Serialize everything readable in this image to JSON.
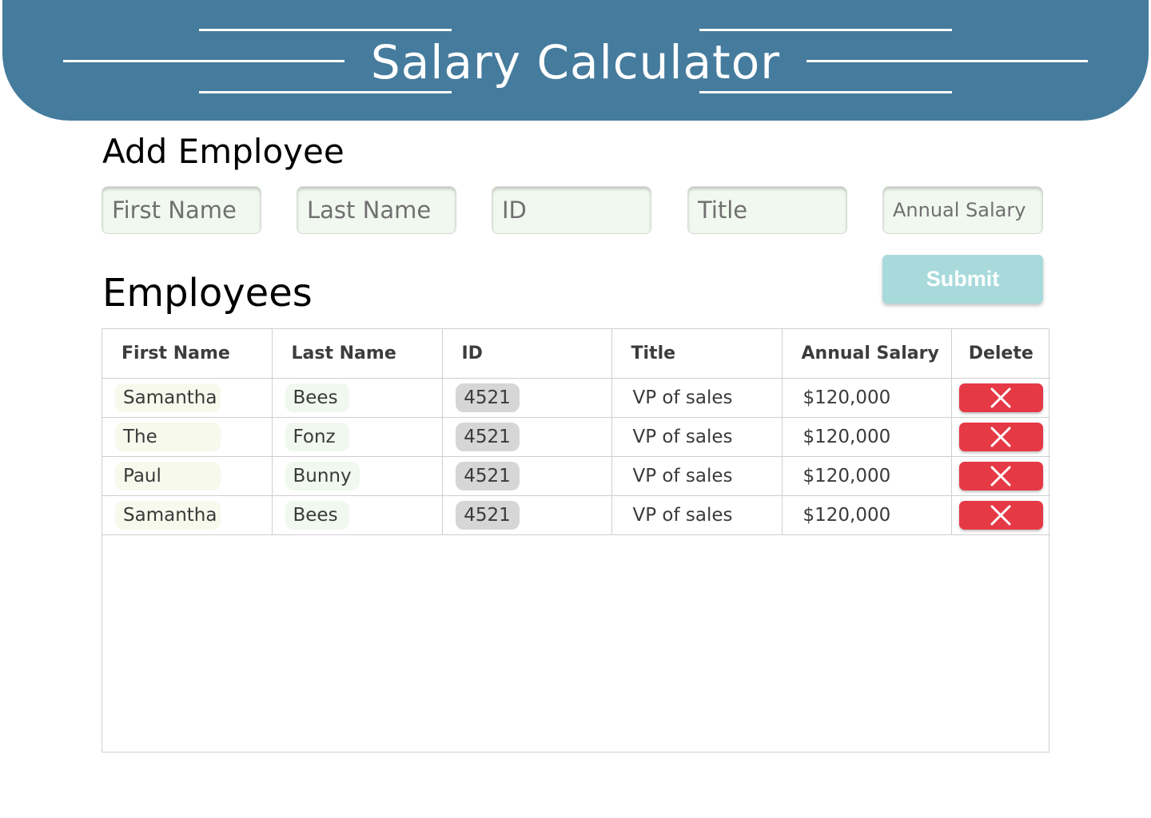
{
  "header": {
    "title": "Salary Calculator",
    "background_color": "#457b9d"
  },
  "add_employee": {
    "title": "Add Employee",
    "fields": [
      {
        "placeholder": "First Name"
      },
      {
        "placeholder": "Last Name"
      },
      {
        "placeholder": "ID"
      },
      {
        "placeholder": "Title"
      },
      {
        "placeholder": "Annual Salary"
      }
    ],
    "submit_label": "Submit",
    "submit_color": "#a8dadc"
  },
  "employees": {
    "title": "Employees",
    "columns": [
      "First Name",
      "Last Name",
      "ID",
      "Title",
      "Annual Salary",
      "Delete"
    ],
    "rows": [
      {
        "first_name": "Samantha",
        "last_name": "Bees",
        "id": "4521",
        "title": "VP of sales",
        "salary": "$120,000"
      },
      {
        "first_name": "The",
        "last_name": "Fonz",
        "id": "4521",
        "title": "VP of sales",
        "salary": "$120,000"
      },
      {
        "first_name": "Paul",
        "last_name": "Bunny",
        "id": "4521",
        "title": "VP of sales",
        "salary": "$120,000"
      },
      {
        "first_name": "Samantha",
        "last_name": "Bees",
        "id": "4521",
        "title": "VP of sales",
        "salary": "$120,000"
      }
    ],
    "delete_icon": "close-icon",
    "delete_color": "#e63946"
  }
}
